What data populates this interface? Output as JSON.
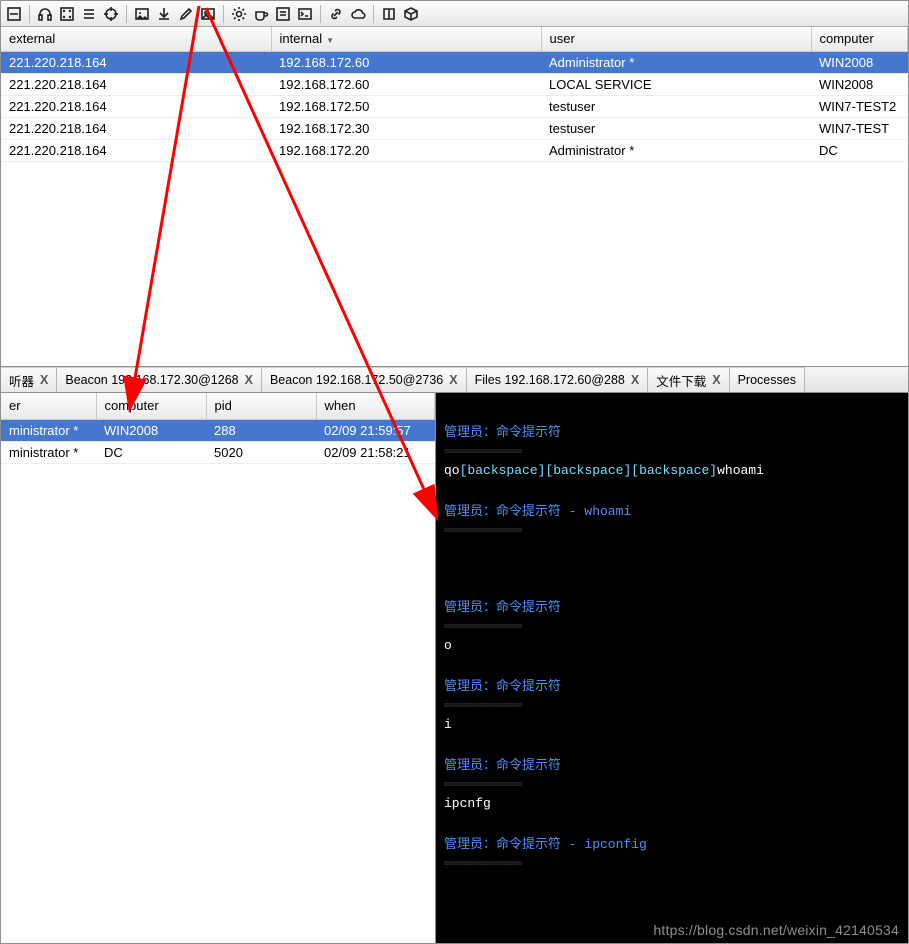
{
  "toolbar_icons": [
    "minimize-icon",
    "headphones-icon",
    "dice-icon",
    "list-icon",
    "target-icon",
    "image-box-icon",
    "download-icon",
    "pencil-icon",
    "picture-icon",
    "gear-icon",
    "coffee-icon",
    "text-icon",
    "terminal-icon",
    "link-icon",
    "cloud-icon",
    "book-icon",
    "package-icon"
  ],
  "sessions": {
    "headers": {
      "external": "external",
      "internal": "internal",
      "user": "user",
      "computer": "computer"
    },
    "sort_indicator": "▼",
    "rows": [
      {
        "external": "221.220.218.164",
        "internal": "192.168.172.60",
        "user": "Administrator *",
        "computer": "WIN2008",
        "selected": true
      },
      {
        "external": "221.220.218.164",
        "internal": "192.168.172.60",
        "user": "LOCAL SERVICE",
        "computer": "WIN2008"
      },
      {
        "external": "221.220.218.164",
        "internal": "192.168.172.50",
        "user": "testuser",
        "computer": "WIN7-TEST2"
      },
      {
        "external": "221.220.218.164",
        "internal": "192.168.172.30",
        "user": "testuser",
        "computer": "WIN7-TEST"
      },
      {
        "external": "221.220.218.164",
        "internal": "192.168.172.20",
        "user": "Administrator *",
        "computer": "DC"
      }
    ]
  },
  "tabs": [
    {
      "label": "听器",
      "close_label": "X"
    },
    {
      "label": "Beacon 192.168.172.30@1268",
      "close_label": "X"
    },
    {
      "label": "Beacon 192.168.172.50@2736",
      "close_label": "X"
    },
    {
      "label": "Files 192.168.172.60@288",
      "close_label": "X"
    },
    {
      "label": "文件下载",
      "close_label": "X"
    },
    {
      "label": "Processes",
      "close_label": "",
      "noclose": true
    }
  ],
  "processes": {
    "headers": {
      "er": "er",
      "computer": "computer",
      "pid": "pid",
      "when": "when"
    },
    "rows": [
      {
        "er": "ministrator *",
        "computer": "WIN2008",
        "pid": "288",
        "when": "02/09 21:59:57",
        "selected": true
      },
      {
        "er": "ministrator *",
        "computer": "DC",
        "pid": "5020",
        "when": "02/09 21:58:21"
      }
    ]
  },
  "console": {
    "lines": [
      {
        "kind": "blank"
      },
      {
        "kind": "title",
        "text": "管理员：命令提示符"
      },
      {
        "kind": "rule"
      },
      {
        "kind": "mixed",
        "parts": [
          {
            "cls": "wht",
            "text": "qo"
          },
          {
            "cls": "cyan",
            "text": "[backspace]"
          },
          {
            "cls": "cyan",
            "text": "[backspace]"
          },
          {
            "cls": "cyan",
            "text": "[backspace]"
          },
          {
            "cls": "wht",
            "text": "whoami"
          }
        ]
      },
      {
        "kind": "blank"
      },
      {
        "kind": "title",
        "text": "管理员：命令提示符 - whoami"
      },
      {
        "kind": "rule"
      },
      {
        "kind": "blank"
      },
      {
        "kind": "blank"
      },
      {
        "kind": "blank"
      },
      {
        "kind": "title",
        "text": "管理员：命令提示符"
      },
      {
        "kind": "rule"
      },
      {
        "kind": "plain",
        "text": "o"
      },
      {
        "kind": "blank"
      },
      {
        "kind": "title",
        "text": "管理员：命令提示符"
      },
      {
        "kind": "rule"
      },
      {
        "kind": "plain",
        "text": "i"
      },
      {
        "kind": "blank"
      },
      {
        "kind": "title",
        "text": "管理员：命令提示符"
      },
      {
        "kind": "rule"
      },
      {
        "kind": "plain",
        "text": "ipcnfg"
      },
      {
        "kind": "blank"
      },
      {
        "kind": "title",
        "text": "管理员：命令提示符 - ipconfig"
      },
      {
        "kind": "rule"
      }
    ]
  },
  "watermark": "https://blog.csdn.net/weixin_42140534"
}
